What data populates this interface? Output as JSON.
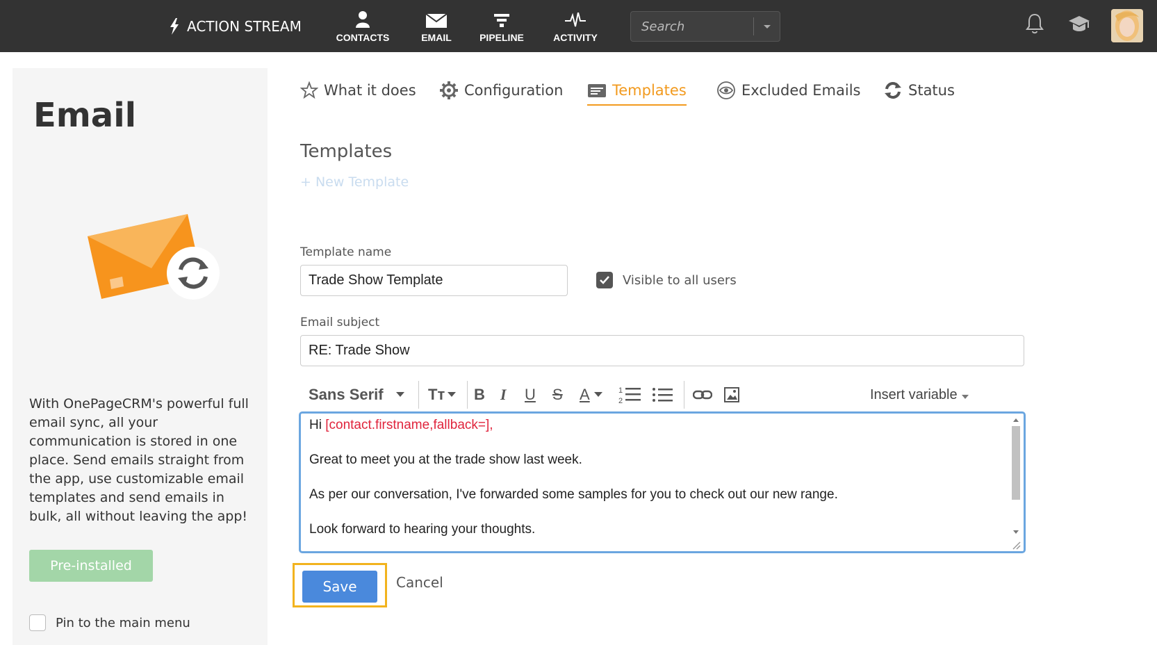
{
  "nav": {
    "brand": "ACTION STREAM",
    "items": [
      {
        "label": "CONTACTS",
        "icon": "person-icon"
      },
      {
        "label": "EMAIL",
        "icon": "envelope-icon"
      },
      {
        "label": "PIPELINE",
        "icon": "funnel-icon"
      },
      {
        "label": "ACTIVITY",
        "icon": "pulse-icon"
      }
    ],
    "search_placeholder": "Search"
  },
  "sidebar": {
    "title": "Email",
    "description": "With OnePageCRM's powerful full email sync, all your communication is stored in one place. Send emails straight from the app, use customizable email templates and send emails in bulk, all without leaving the app!",
    "preinstalled_label": "Pre-installed",
    "pin_label": "Pin to the main menu"
  },
  "tabs": [
    {
      "label": "What it does",
      "icon": "star-icon"
    },
    {
      "label": "Configuration",
      "icon": "gear-icon"
    },
    {
      "label": "Templates",
      "icon": "template-icon",
      "active": true
    },
    {
      "label": "Excluded Emails",
      "icon": "eye-icon"
    },
    {
      "label": "Status",
      "icon": "refresh-icon"
    }
  ],
  "main": {
    "section_title": "Templates",
    "new_template": "+ New Template",
    "template_name_label": "Template name",
    "template_name_value": "Trade Show Template",
    "visible_label": "Visible to all users",
    "visible_checked": true,
    "subject_label": "Email subject",
    "subject_value": "RE: Trade Show",
    "toolbar": {
      "font": "Sans Serif",
      "size_glyph": "Tт",
      "bold": "B",
      "italic": "I",
      "underline": "U",
      "strike": "S",
      "color": "A",
      "insert_variable": "Insert variable"
    },
    "body": {
      "greeting": "Hi",
      "variable": "[contact.firstname,fallback=]",
      "greeting_end": ",",
      "line2": "Great to meet you at the trade show last week.",
      "line3": "As per our conversation, I've forwarded some samples for you to check out our new range.",
      "line4": "Look forward to hearing your thoughts."
    },
    "save_label": "Save",
    "cancel_label": "Cancel"
  },
  "colors": {
    "accent": "#f29a1e",
    "primary": "#4a89dc",
    "topbar": "#333333",
    "variable": "#e0243c"
  }
}
